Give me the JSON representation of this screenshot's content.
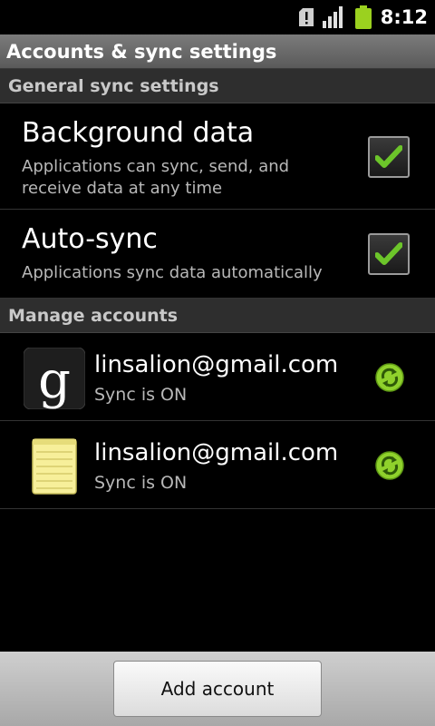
{
  "status_bar": {
    "time": "8:12",
    "icons": [
      "sd-card-alert-icon",
      "signal-icon",
      "battery-icon"
    ]
  },
  "title_bar": {
    "title": "Accounts & sync settings"
  },
  "general_section": {
    "header": "General sync settings",
    "items": [
      {
        "title": "Background data",
        "summary": "Applications can sync, send, and receive data at any time",
        "checked": true
      },
      {
        "title": "Auto-sync",
        "summary": "Applications sync data automatically",
        "checked": true
      }
    ]
  },
  "manage_section": {
    "header": "Manage accounts",
    "accounts": [
      {
        "icon": "google-icon",
        "email": "linsalion@gmail.com",
        "status": "Sync is ON"
      },
      {
        "icon": "notepad-icon",
        "email": "linsalion@gmail.com",
        "status": "Sync is ON"
      }
    ]
  },
  "bottom_bar": {
    "add_account_label": "Add account"
  },
  "colors": {
    "check_green": "#6cc52a",
    "sync_green": "#8fd12c",
    "section_bg": "#2e2e2e",
    "title_bg": "#6a6a6a"
  }
}
